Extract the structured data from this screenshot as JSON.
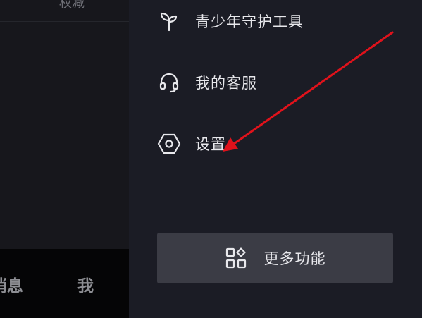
{
  "left_panel": {
    "top_text": "权减",
    "bottom_nav": {
      "messages_label": "消息",
      "me_label": "我"
    }
  },
  "drawer": {
    "items": [
      {
        "label": "青少年守护工具",
        "icon": "sprout-icon"
      },
      {
        "label": "我的客服",
        "icon": "headset-icon"
      },
      {
        "label": "设置",
        "icon": "hexagon-settings-icon"
      }
    ],
    "more_button": {
      "label": "更多功能",
      "icon": "grid-apps-icon"
    }
  },
  "colors": {
    "drawer_bg": "#1b1c25",
    "button_bg": "#3b3c45",
    "annotation_arrow": "#e0121b",
    "text_primary": "#e8e8ec"
  }
}
